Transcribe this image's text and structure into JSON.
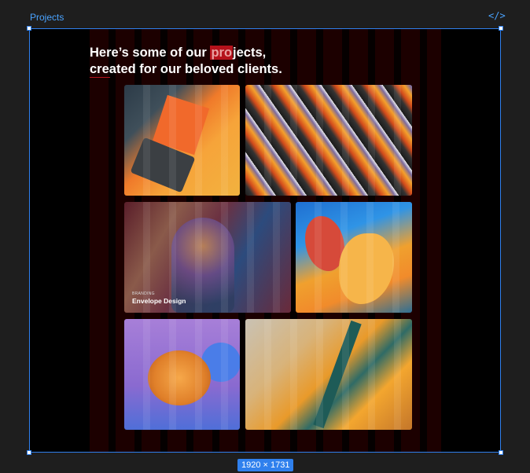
{
  "frame": {
    "label": "Projects",
    "dimensions": "1920 × 1731"
  },
  "headline": {
    "line1_prefix": "Here’s some of our ",
    "line1_highlight": "pro",
    "line1_suffix": "jects,",
    "line2": "created for our beloved clients."
  },
  "cards": [
    {
      "name": "change-by-design"
    },
    {
      "name": "abstract-collage"
    },
    {
      "name": "envelope-design",
      "tag": "BRANDING",
      "title": "Envelope Design"
    },
    {
      "name": "abstract-shapes"
    },
    {
      "name": "3d-render"
    },
    {
      "name": "marble-texture"
    }
  ],
  "colors": {
    "accent": "#b5121b",
    "selection": "#2f80ed"
  }
}
